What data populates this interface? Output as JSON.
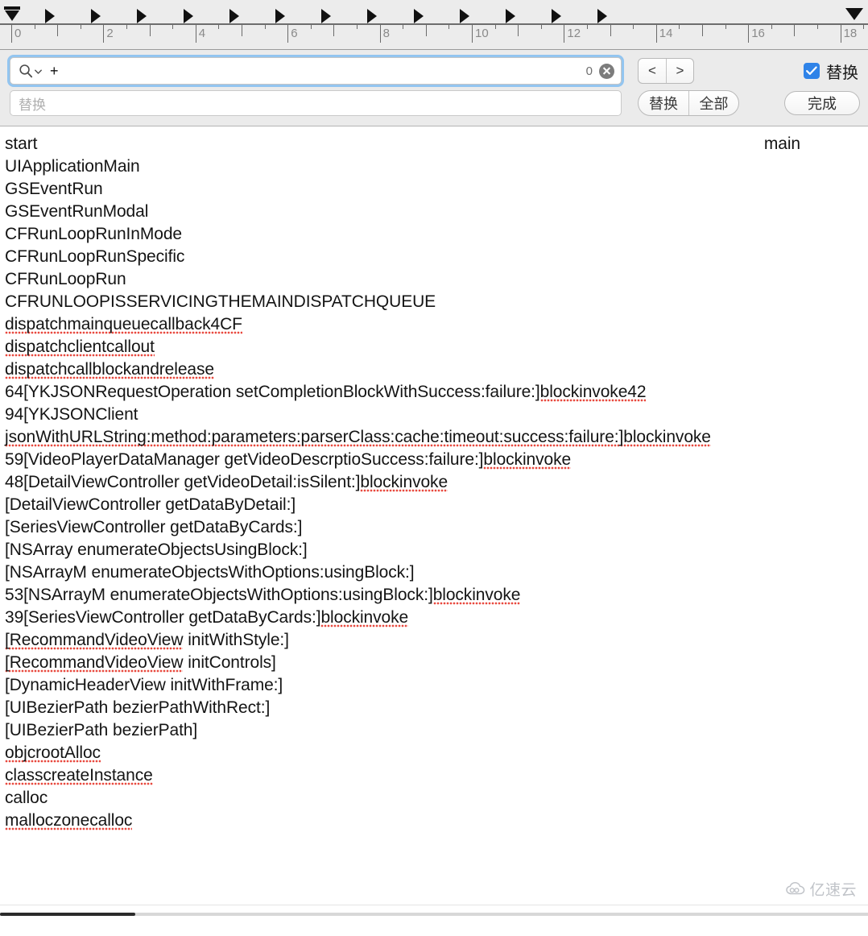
{
  "ruler": {
    "unit_labels": [
      "0",
      "2",
      "4",
      "6",
      "8",
      "10",
      "12",
      "14",
      "16",
      "18"
    ],
    "left_indent_marker": "left-indent-marker",
    "right_indent_marker": "right-indent-marker",
    "tab_stop_icon": "tab-stop-flag-icon",
    "tab_stop_count": 13
  },
  "findbar": {
    "search": {
      "icon": "search-magnifier-icon",
      "dropdown_icon": "chevron-down-icon",
      "value": "+",
      "match_count": "0",
      "clear_icon": "clear-circle-x-icon"
    },
    "replace": {
      "placeholder": "替换",
      "value": ""
    },
    "prev_label": "<",
    "next_label": ">",
    "replace_button_label": "替换",
    "replace_all_button_label": "全部",
    "done_button_label": "完成",
    "replace_toggle_label": "替换",
    "replace_toggle_checked": true,
    "accent_color": "#2f83e8",
    "focus_ring_color": "#93c5f0"
  },
  "document": {
    "first_line": {
      "left": "start",
      "right": "main"
    },
    "lines": [
      {
        "text": "UIApplicationMain",
        "misspelled": false
      },
      {
        "text": "GSEventRun",
        "misspelled": false
      },
      {
        "text": "GSEventRunModal",
        "misspelled": false
      },
      {
        "text": "CFRunLoopRunInMode",
        "misspelled": false
      },
      {
        "text": "CFRunLoopRunSpecific",
        "misspelled": false
      },
      {
        "text": "CFRunLoopRun",
        "misspelled": false
      },
      {
        "text": "CFRUNLOOPISSERVICINGTHEMAINDISPATCHQUEUE",
        "misspelled": false
      },
      {
        "text": "dispatchmainqueuecallback4CF",
        "misspelled": true
      },
      {
        "text": "dispatchclientcallout",
        "misspelled": true
      },
      {
        "text": "dispatchcallblockandrelease",
        "misspelled": true
      },
      {
        "prefix": "64[YKJSONRequestOperation setCompletionBlockWithSuccess:failure:]",
        "suffix": "blockinvoke42",
        "misspelled": true
      },
      {
        "text": "94[YKJSONClient",
        "misspelled": false
      },
      {
        "prefix": "jsonWithURLString:method:parameters:parserClass:cache:timeout:success:failure:]",
        "suffix": "blockinvoke",
        "misspelled": true,
        "prefix_misspelled": true
      },
      {
        "prefix": "59[VideoPlayerDataManager getVideoDescrptioSuccess:failure:]",
        "suffix": "blockinvoke",
        "misspelled": true
      },
      {
        "prefix": "48[DetailViewController getVideoDetail:isSilent:]",
        "suffix": "blockinvoke",
        "misspelled": true
      },
      {
        "text": "[DetailViewController getDataByDetail:]",
        "misspelled": false
      },
      {
        "text": "[SeriesViewController getDataByCards:]",
        "misspelled": false
      },
      {
        "text": "[NSArray enumerateObjectsUsingBlock:]",
        "misspelled": false
      },
      {
        "text": "[NSArrayM enumerateObjectsWithOptions:usingBlock:]",
        "misspelled": false
      },
      {
        "prefix": "53[NSArrayM enumerateObjectsWithOptions:usingBlock:]",
        "suffix": "blockinvoke",
        "misspelled": true
      },
      {
        "prefix": "39[SeriesViewController getDataByCards:]",
        "suffix": "blockinvoke",
        "misspelled": true
      },
      {
        "prefix": "[RecommandVideoView",
        "suffix": " initWithStyle:]",
        "misspelled": false,
        "prefix_misspelled": true
      },
      {
        "prefix": "[RecommandVideoView",
        "suffix": " initControls]",
        "misspelled": false,
        "prefix_misspelled": true
      },
      {
        "text": "[DynamicHeaderView initWithFrame:]",
        "misspelled": false
      },
      {
        "text": "[UIBezierPath bezierPathWithRect:]",
        "misspelled": false
      },
      {
        "text": "[UIBezierPath bezierPath]",
        "misspelled": false
      },
      {
        "text": "objcrootAlloc",
        "misspelled": true
      },
      {
        "text": "classcreateInstance",
        "misspelled": true
      },
      {
        "text": "calloc",
        "misspelled": false
      },
      {
        "text": "malloczonecalloc",
        "misspelled": true
      }
    ]
  },
  "scrollbar": {
    "orientation": "horizontal",
    "thumb_name": "horizontal-scrollbar-thumb"
  },
  "watermark": {
    "text": "亿速云",
    "icon": "cloud-logo-icon"
  }
}
